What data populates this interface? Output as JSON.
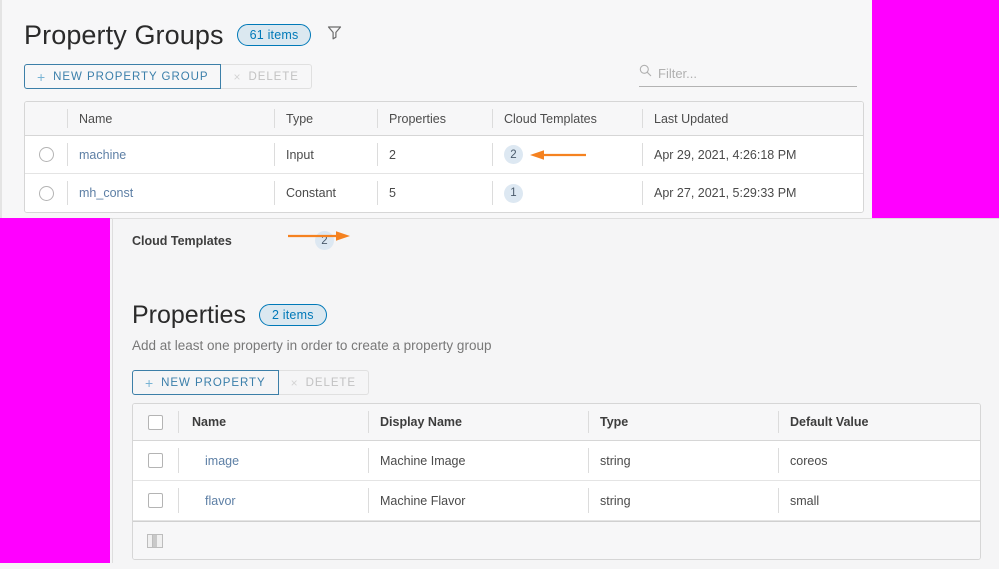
{
  "top": {
    "title": "Property Groups",
    "count_badge": "61 items",
    "filter_icon": "funnel-icon",
    "new_button": {
      "label": "NEW PROPERTY GROUP",
      "plus": "+"
    },
    "delete_button": {
      "label": "DELETE",
      "x": "×"
    },
    "search": {
      "placeholder": "Filter...",
      "value": "",
      "icon": "search-icon"
    },
    "table": {
      "columns": [
        "Name",
        "Type",
        "Properties",
        "Cloud Templates",
        "Last Updated"
      ],
      "rows": [
        {
          "name": "machine",
          "type": "Input",
          "properties": "2",
          "cloud_templates": "2",
          "last_updated": "Apr 29, 2021, 4:26:18 PM"
        },
        {
          "name": "mh_const",
          "type": "Constant",
          "properties": "5",
          "cloud_templates": "1",
          "last_updated": "Apr 27, 2021, 5:29:33 PM"
        }
      ]
    }
  },
  "bottom": {
    "cloud_templates_label": "Cloud Templates",
    "cloud_templates_count": "2",
    "properties_title": "Properties",
    "properties_badge": "2 items",
    "properties_subtitle": "Add at least one property in order to create a property group",
    "new_button": {
      "label": "NEW PROPERTY",
      "plus": "+"
    },
    "delete_button": {
      "label": "DELETE",
      "x": "×"
    },
    "table": {
      "columns": [
        "Name",
        "Display Name",
        "Type",
        "Default Value"
      ],
      "rows": [
        {
          "name": "image",
          "display_name": "Machine Image",
          "type": "string",
          "default_value": "coreos"
        },
        {
          "name": "flavor",
          "display_name": "Machine Flavor",
          "type": "string",
          "default_value": "small"
        }
      ]
    }
  },
  "annotations": {
    "arrow_color": "#f58220",
    "arrow_top": "arrow-pointing-left",
    "arrow_mid": "arrow-pointing-right"
  },
  "occluders": {
    "color": "#ff00ff"
  }
}
